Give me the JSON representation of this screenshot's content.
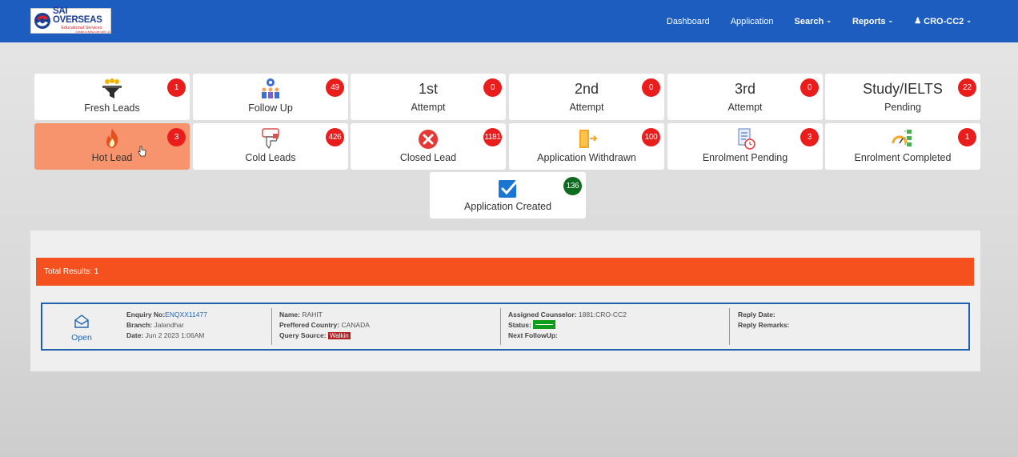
{
  "brand": {
    "name": "SAI OVERSEAS",
    "subtitle": "Educational Services",
    "tagline": "Create a New Life with Us",
    "colors": {
      "primary": "#1c5dbf",
      "accent": "#f4511e",
      "badge": "#ea1d1d"
    }
  },
  "nav": {
    "dashboard": "Dashboard",
    "application": "Application",
    "search": "Search",
    "reports": "Reports",
    "user": "CRO-CC2"
  },
  "cards": {
    "fresh_leads": {
      "label": "Fresh Leads",
      "count": "1",
      "icon": "funnel-icon"
    },
    "follow_up": {
      "label": "Follow Up",
      "count": "49",
      "icon": "team-gear-icon"
    },
    "attempt1": {
      "big": "1st",
      "sub": "Attempt",
      "count": "0"
    },
    "attempt2": {
      "big": "2nd",
      "sub": "Attempt",
      "count": "0"
    },
    "attempt3": {
      "big": "3rd",
      "sub": "Attempt",
      "count": "0"
    },
    "study_ielts": {
      "big": "Study/IELTS",
      "sub": "Pending",
      "count": "22"
    },
    "hot_lead": {
      "label": "Hot Lead",
      "count": "3",
      "icon": "fire-icon"
    },
    "cold_leads": {
      "label": "Cold Leads",
      "count": "426",
      "icon": "thumbs-down-icon"
    },
    "closed_lead": {
      "label": "Closed Lead",
      "count": "1181",
      "icon": "close-circle-icon"
    },
    "app_withdrawn": {
      "label": "Application Withdrawn",
      "count": "100",
      "icon": "exit-door-icon"
    },
    "enrol_pending": {
      "label": "Enrolment Pending",
      "count": "3",
      "icon": "document-clock-icon"
    },
    "enrol_completed": {
      "label": "Enrolment Completed",
      "count": "1",
      "icon": "gauge-checklist-icon"
    },
    "app_created": {
      "label": "Application Created",
      "count": "136",
      "icon": "checkbox-icon"
    }
  },
  "results": {
    "total": "Total Results: 1"
  },
  "lead": {
    "open_label": "Open",
    "enquiry_label": "Enquiry No:",
    "enquiry_value": "ENQXX11477",
    "branch_label": "Branch:",
    "branch_value": "Jalandhar",
    "date_label": "Date:",
    "date_value": "Jun 2 2023 1:06AM",
    "name_label": "Name:",
    "name_value": "RAHIT",
    "country_label": "Preffered Country:",
    "country_value": "CANADA",
    "source_label": "Query Source:",
    "source_value": "Walkin",
    "counselor_label": "Assigned Counselor:",
    "counselor_value": "1881:CRO-CC2",
    "status_label": "Status:",
    "followup_label": "Next FollowUp:",
    "reply_date_label": "Reply Date:",
    "reply_remarks_label": "Reply Remarks:"
  }
}
